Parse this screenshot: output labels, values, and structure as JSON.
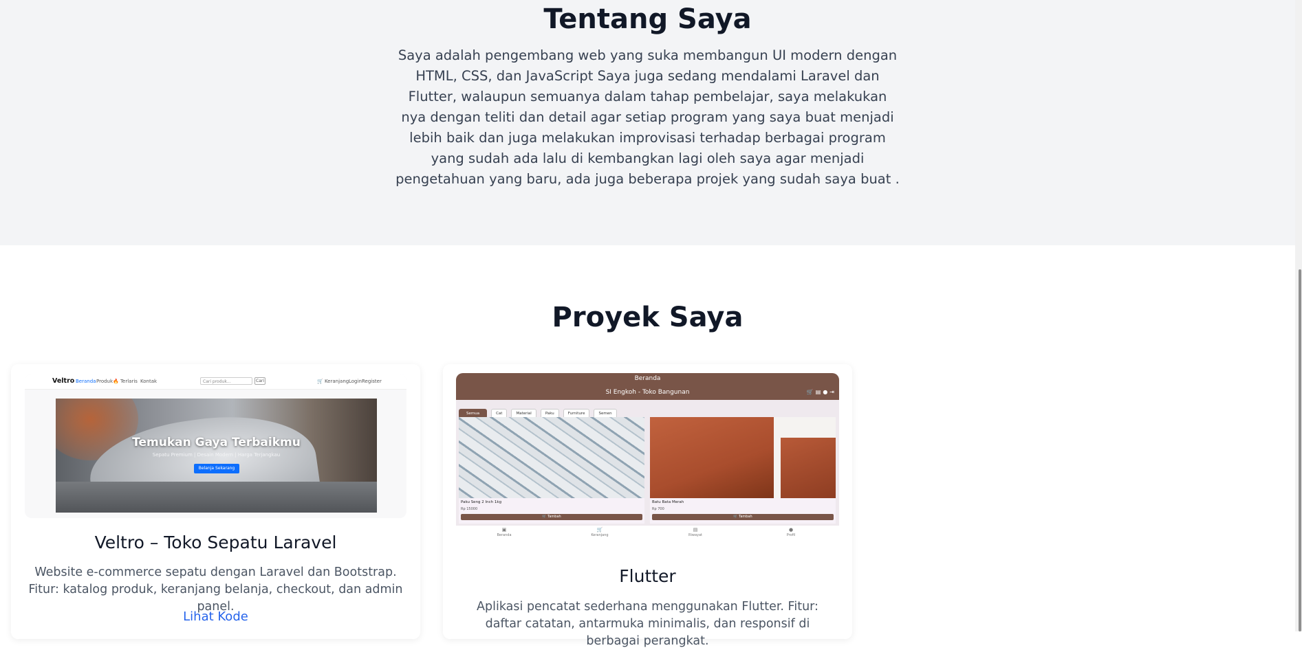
{
  "about": {
    "title": "Tentang Saya",
    "text": "Saya adalah pengembang web yang suka membangun UI modern dengan HTML, CSS, dan JavaScript Saya juga sedang mendalami Laravel dan Flutter, walaupun semuanya dalam tahap pembelajar, saya melakukan nya dengan teliti dan detail agar setiap program yang saya buat menjadi lebih baik dan juga melakukan improvisasi terhadap berbagai program yang sudah ada lalu di kembangkan lagi oleh saya agar menjadi pengetahuan yang baru, ada juga beberapa projek yang sudah saya buat ."
  },
  "projects": {
    "title": "Proyek Saya",
    "items": [
      {
        "title": "Veltro – Toko Sepatu Laravel",
        "description": "Website e-commerce sepatu dengan Laravel dan Bootstrap. Fitur: katalog produk, keranjang belanja, checkout, dan admin panel.",
        "link": "Lihat Kode",
        "screenshot": {
          "brand": "Veltro",
          "nav": [
            "Beranda",
            "Produk",
            "🔥 Terlaris",
            "Kontak"
          ],
          "search_placeholder": "Cari produk...",
          "search_button": "Cari",
          "nav_right": [
            "🛒 Keranjang",
            "Login",
            "Register"
          ],
          "hero_title": "Temukan Gaya Terbaikmu",
          "hero_subtitle": "Sepatu Premium | Desain Modern | Harga Terjangkau",
          "hero_button": "Belanja Sekarang"
        }
      },
      {
        "title": "Flutter",
        "description": "Aplikasi pencatat sederhana menggunakan Flutter. Fitur: daftar catatan, antarmuka minimalis, dan responsif di berbagai perangkat.",
        "screenshot": {
          "top_title": "Beranda",
          "app_title": "SI Engkoh - Toko Bangunan",
          "chips": [
            "Semua",
            "Cat",
            "Material",
            "Paku",
            "Furniture",
            "Semen"
          ],
          "products": [
            {
              "name": "Paku Seng 2 Inch 1kg",
              "price": "Rp 15000",
              "button": "🛒 Tambah"
            },
            {
              "name": "Batu Bata Merah",
              "price": "Rp 700",
              "button": "🛒 Tambah"
            }
          ],
          "bottom_nav": [
            "Beranda",
            "Keranjang",
            "Riwayat",
            "Profil"
          ]
        }
      }
    ]
  }
}
